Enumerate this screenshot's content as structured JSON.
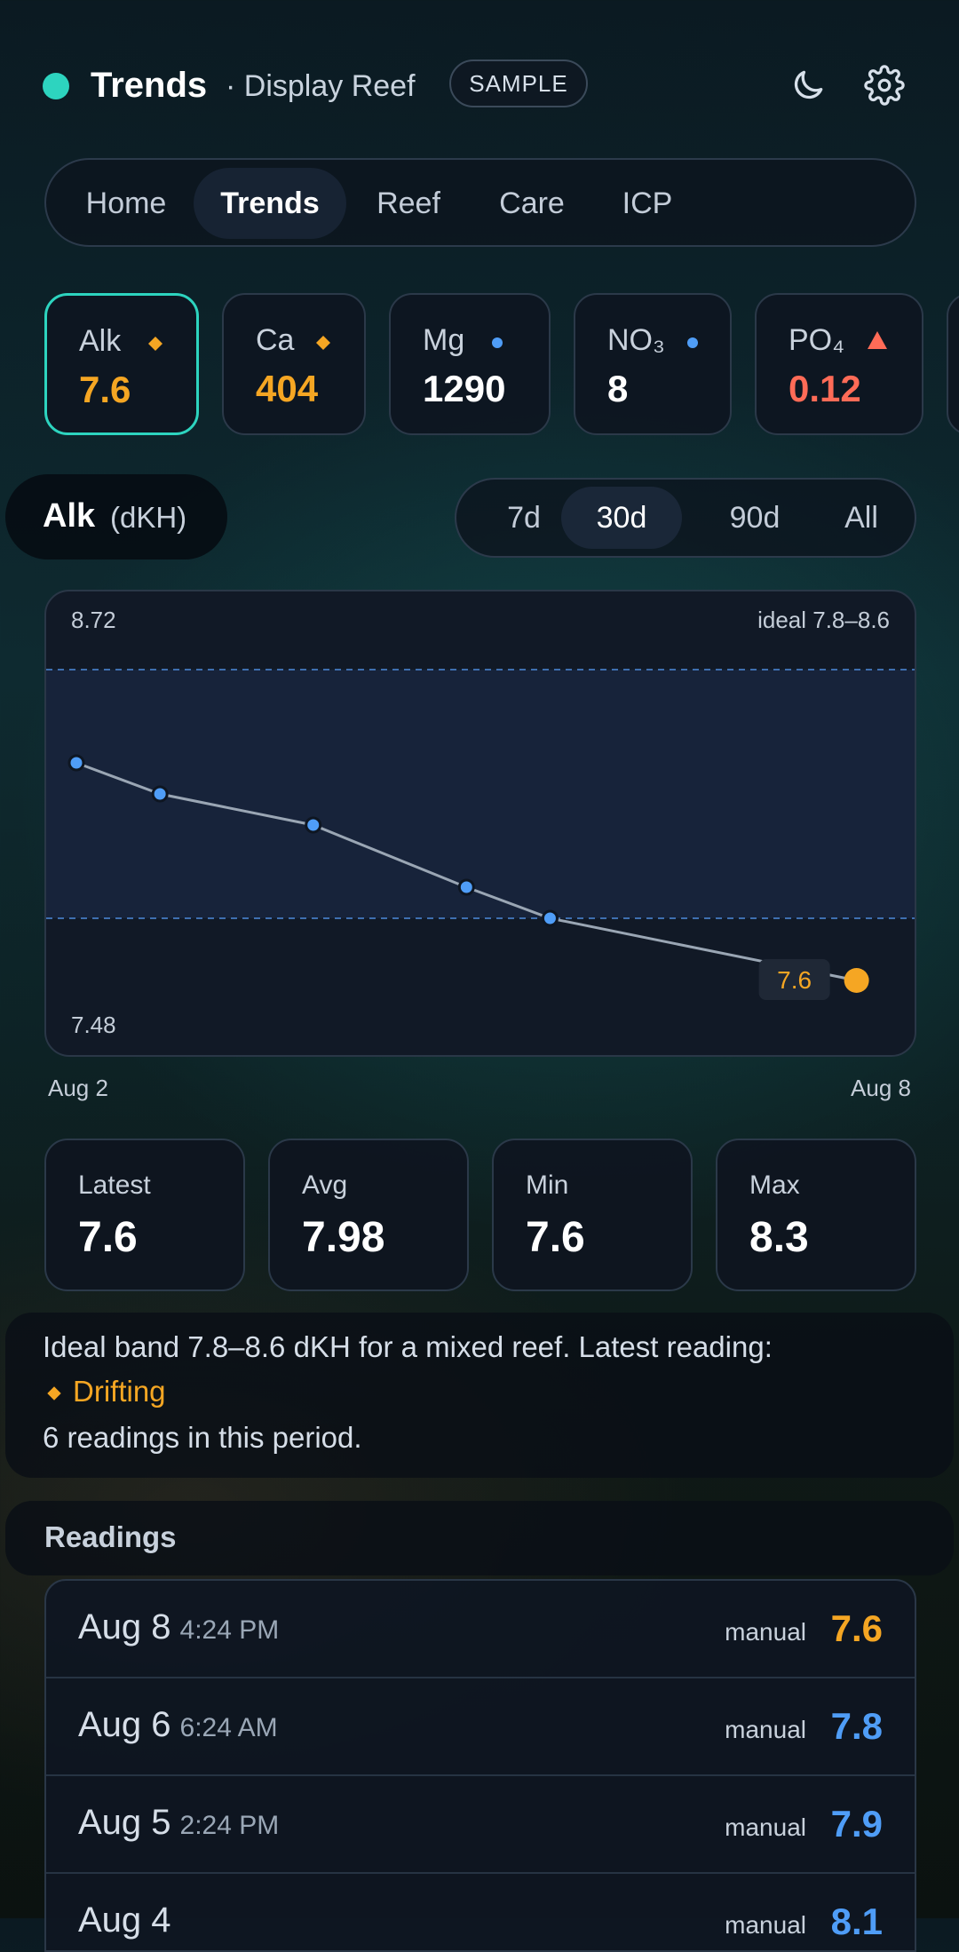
{
  "header": {
    "title": "Trends",
    "subtitle": "· Display Reef",
    "badge": "SAMPLE",
    "status_color": "#2dd4bf",
    "icons": [
      "moon-icon",
      "gear-icon"
    ]
  },
  "nav": {
    "tabs": [
      {
        "label": "Home",
        "active": false
      },
      {
        "label": "Trends",
        "active": true
      },
      {
        "label": "Reef",
        "active": false
      },
      {
        "label": "Care",
        "active": false
      },
      {
        "label": "ICP",
        "active": false
      }
    ]
  },
  "params": [
    {
      "label": "Alk",
      "value": "7.6",
      "indicator": "diamond",
      "status": "amber",
      "selected": true
    },
    {
      "label": "Ca",
      "value": "404",
      "indicator": "diamond",
      "status": "amber",
      "selected": false
    },
    {
      "label": "Mg",
      "value": "1290",
      "indicator": "dot",
      "status": "ok",
      "selected": false
    },
    {
      "label": "NO₃",
      "value": "8",
      "indicator": "dot",
      "status": "ok",
      "selected": false
    },
    {
      "label": "PO₄",
      "value": "0.12",
      "indicator": "triangle",
      "status": "high",
      "selected": false
    }
  ],
  "selected_param": {
    "name": "Alk",
    "unit": "(dKH)"
  },
  "ranges": [
    {
      "label": "7d",
      "active": false
    },
    {
      "label": "30d",
      "active": true
    },
    {
      "label": "90d",
      "active": false
    },
    {
      "label": "All",
      "active": false
    }
  ],
  "chart_data": {
    "type": "line",
    "y_max_label": "8.72",
    "y_min_label": "7.48",
    "ylim": [
      7.48,
      8.72
    ],
    "ideal_label": "ideal 7.8–8.6",
    "ideal_band": [
      7.8,
      8.6
    ],
    "x_start_label": "Aug 2",
    "x_end_label": "Aug 8",
    "x": [
      "Aug 2",
      "Aug 3",
      "Aug 4",
      "Aug 5",
      "Aug 6",
      "Aug 8"
    ],
    "x_pos": [
      0,
      1.2,
      3.4,
      5.6,
      6.8,
      11.2
    ],
    "x_span": 11.6,
    "series": [
      {
        "values": [
          8.3,
          8.2,
          8.1,
          7.9,
          7.8,
          7.6
        ]
      }
    ],
    "latest_label": "7.6",
    "colors": {
      "line": "#9aa6b4",
      "point": "#4f9df7",
      "latest": "#f5a623"
    }
  },
  "stats": [
    {
      "label": "Latest",
      "value": "7.6"
    },
    {
      "label": "Avg",
      "value": "7.98"
    },
    {
      "label": "Min",
      "value": "7.6"
    },
    {
      "label": "Max",
      "value": "8.3"
    }
  ],
  "note": {
    "line1": "Ideal band 7.8–8.6 dKH for a mixed reef. Latest reading:",
    "status_label": "Drifting",
    "line3": "6 readings in this period."
  },
  "readings": {
    "heading": "Readings",
    "rows": [
      {
        "date": "Aug 8",
        "time": "4:24 PM",
        "source": "manual",
        "value": "7.6",
        "color": "amber"
      },
      {
        "date": "Aug 6",
        "time": "6:24 AM",
        "source": "manual",
        "value": "7.8",
        "color": "blue"
      },
      {
        "date": "Aug 5",
        "time": "2:24 PM",
        "source": "manual",
        "value": "7.9",
        "color": "blue"
      },
      {
        "date": "Aug 4",
        "time": "",
        "source": "manual",
        "value": "8.1",
        "color": "blue"
      }
    ]
  }
}
